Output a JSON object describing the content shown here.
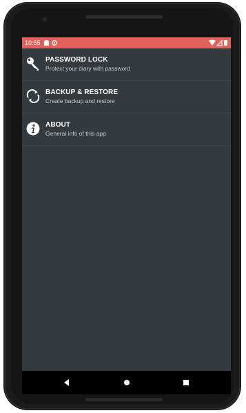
{
  "status_bar": {
    "time": "10:55",
    "background": "#e0625a",
    "left_icons": [
      "notification-card-icon",
      "circle-app-icon"
    ],
    "right_icons": [
      "wifi-icon",
      "signal-icon",
      "battery-icon"
    ]
  },
  "settings": {
    "items": [
      {
        "icon": "key-icon",
        "title": "PASSWORD LOCK",
        "subtitle": "Protect your diary with password"
      },
      {
        "icon": "sync-icon",
        "title": "BACKUP & RESTORE",
        "subtitle": "Create backup and restore"
      },
      {
        "icon": "info-icon",
        "title": "ABOUT",
        "subtitle": "General info of this app"
      }
    ]
  },
  "nav_bar": {
    "buttons": [
      "back-icon",
      "home-icon",
      "recents-icon"
    ]
  },
  "colors": {
    "screen_background": "#353a3f",
    "accent": "#e0625a",
    "title_text": "#ffffff",
    "subtitle_text": "#c9ccd0"
  }
}
